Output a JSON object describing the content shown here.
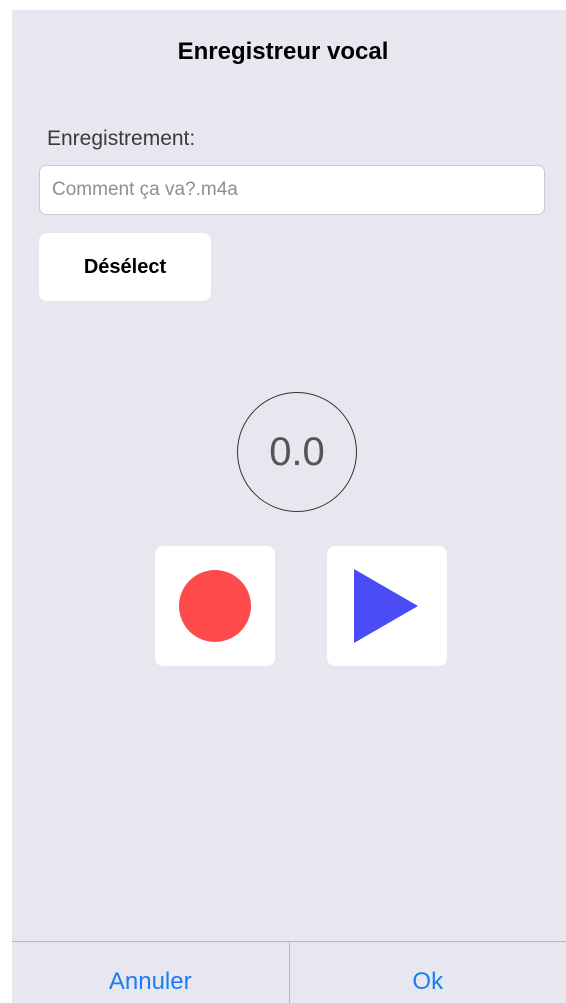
{
  "header": {
    "title": "Enregistreur vocal"
  },
  "form": {
    "label": "Enregistrement:",
    "filename_placeholder": "Comment ça va?.m4a",
    "filename_value": "",
    "deselect_label": "Désélect"
  },
  "player": {
    "elapsed": "0.0",
    "record_icon": "record-circle",
    "play_icon": "play-triangle"
  },
  "footer": {
    "cancel_label": "Annuler",
    "ok_label": "Ok"
  },
  "colors": {
    "background": "#e7e7ef",
    "record": "#fe4a4a",
    "play": "#4b4cf5",
    "link": "#1b7cf5"
  }
}
